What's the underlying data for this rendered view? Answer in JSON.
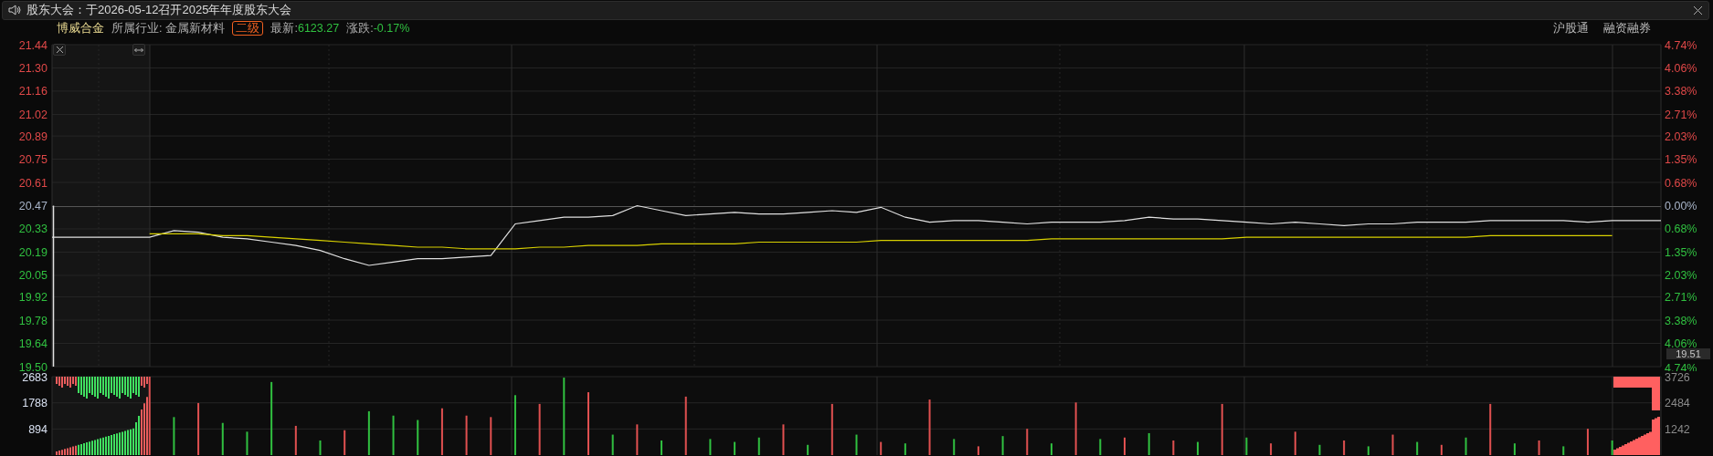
{
  "notice": {
    "text": "股东大会：于2026-05-12召开2025年年度股东大会"
  },
  "stock": {
    "name": "博威合金",
    "industry_label": "所属行业:",
    "industry": "金属新材料",
    "level_badge": "二级",
    "latest_label": "最新:",
    "latest": "6123.27",
    "change_label": "涨跌:",
    "change": "-0.17%",
    "falling": true
  },
  "tags": [
    "沪股通",
    "融资融券"
  ],
  "price_chart": {
    "chart_data": {
      "type": "line",
      "grid": true,
      "series": [
        {
          "color": "#e0e0e0",
          "values": [
            20.28,
            20.28,
            20.28,
            20.28,
            20.28,
            20.32,
            20.31,
            20.28,
            20.27,
            20.25,
            20.23,
            20.2,
            20.15,
            20.11,
            20.13,
            20.15,
            20.15,
            20.16,
            20.17,
            20.36,
            20.38,
            20.4,
            20.4,
            20.41,
            20.47,
            20.44,
            20.41,
            20.42,
            20.43,
            20.42,
            20.42,
            20.43,
            20.44,
            20.43,
            20.46,
            20.4,
            20.37,
            20.38,
            20.38,
            20.37,
            20.36,
            20.37,
            20.37,
            20.37,
            20.38,
            20.4,
            20.39,
            20.39,
            20.38,
            20.37,
            20.36,
            20.37,
            20.36,
            20.35,
            20.36,
            20.36,
            20.37,
            20.37,
            20.37,
            20.38,
            20.38,
            20.38,
            20.38,
            20.37,
            20.38,
            20.38,
            20.38
          ]
        },
        {
          "color": "#d8d000",
          "values": [
            null,
            null,
            null,
            null,
            20.3,
            20.3,
            20.3,
            20.29,
            20.29,
            20.28,
            20.27,
            20.26,
            20.25,
            20.24,
            20.23,
            20.22,
            20.22,
            20.21,
            20.21,
            20.21,
            20.22,
            20.22,
            20.23,
            20.23,
            20.23,
            20.24,
            20.24,
            20.24,
            20.24,
            20.25,
            20.25,
            20.25,
            20.25,
            20.25,
            20.26,
            20.26,
            20.26,
            20.26,
            20.26,
            20.26,
            20.26,
            20.27,
            20.27,
            20.27,
            20.27,
            20.27,
            20.27,
            20.27,
            20.27,
            20.28,
            20.28,
            20.28,
            20.28,
            20.28,
            20.28,
            20.28,
            20.28,
            20.28,
            20.28,
            20.29,
            20.29,
            20.29,
            20.29,
            20.29,
            20.29,
            null,
            null
          ]
        }
      ],
      "ylim": [
        19.5,
        21.44
      ],
      "ref_lines": [
        {
          "value": 20.47,
          "axis": "y",
          "color": "#555555"
        }
      ],
      "yticks": [
        {
          "value": 21.44,
          "label": "21.44"
        },
        {
          "value": 21.3,
          "label": "21.30"
        },
        {
          "value": 21.16,
          "label": "21.16"
        },
        {
          "value": 21.02,
          "label": "21.02"
        },
        {
          "value": 20.89,
          "label": "20.89"
        },
        {
          "value": 20.75,
          "label": "20.75"
        },
        {
          "value": 20.61,
          "label": "20.61"
        },
        {
          "value": 20.47,
          "label": "20.47"
        },
        {
          "value": 20.33,
          "label": "20.33"
        },
        {
          "value": 20.19,
          "label": "20.19"
        },
        {
          "value": 20.05,
          "label": "20.05"
        },
        {
          "value": 19.92,
          "label": "19.92"
        },
        {
          "value": 19.78,
          "label": "19.78"
        },
        {
          "value": 19.64,
          "label": "19.64"
        },
        {
          "value": 19.5,
          "label": "19.50"
        }
      ]
    },
    "right_ticks": [
      {
        "label": "4.74%",
        "color": "#e04848"
      },
      {
        "label": "4.06%",
        "color": "#e04848"
      },
      {
        "label": "3.38%",
        "color": "#e04848"
      },
      {
        "label": "2.71%",
        "color": "#e04848"
      },
      {
        "label": "2.03%",
        "color": "#e04848"
      },
      {
        "label": "1.35%",
        "color": "#e04848"
      },
      {
        "label": "0.68%",
        "color": "#e04848"
      },
      {
        "label": "0.00%",
        "color": "#a8b4c8"
      },
      {
        "label": "0.68%",
        "color": "#30c040"
      },
      {
        "label": "1.35%",
        "color": "#30c040"
      },
      {
        "label": "2.03%",
        "color": "#30c040"
      },
      {
        "label": "2.71%",
        "color": "#30c040"
      },
      {
        "label": "3.38%",
        "color": "#30c040"
      },
      {
        "label": "4.06%",
        "color": "#30c040"
      },
      {
        "label": "4.74%",
        "color": "#30c040"
      }
    ],
    "current_price": "19.51"
  },
  "volume_chart": {
    "chart_data": {
      "type": "bar",
      "grid": true,
      "series": [
        {
          "color": "#e05050",
          "values": [
            null,
            null,
            null,
            null,
            2683,
            null,
            1780,
            null,
            null,
            null,
            1000,
            null,
            850,
            null,
            null,
            null,
            1600,
            1350,
            1300,
            null,
            1750,
            null,
            2150,
            null,
            1050,
            null,
            2000,
            null,
            null,
            null,
            1050,
            null,
            1750,
            null,
            450,
            null,
            1900,
            null,
            300,
            null,
            900,
            null,
            1800,
            null,
            600,
            null,
            500,
            null,
            1750,
            null,
            400,
            800,
            null,
            500,
            null,
            700,
            null,
            350,
            null,
            1750,
            null,
            500,
            null,
            900,
            null,
            null,
            null
          ]
        },
        {
          "color": "#30c040",
          "values": [
            null,
            null,
            null,
            null,
            null,
            1300,
            null,
            1100,
            800,
            2500,
            null,
            500,
            null,
            1500,
            1350,
            1200,
            null,
            null,
            null,
            2050,
            null,
            2650,
            null,
            700,
            null,
            500,
            null,
            550,
            450,
            600,
            null,
            350,
            null,
            700,
            null,
            400,
            null,
            550,
            null,
            650,
            null,
            400,
            null,
            550,
            null,
            750,
            null,
            450,
            null,
            600,
            null,
            null,
            350,
            null,
            300,
            null,
            450,
            null,
            600,
            null,
            400,
            null,
            300,
            null,
            500,
            null,
            null
          ]
        }
      ],
      "ylim": [
        0,
        2683
      ],
      "yticks": [
        {
          "value": 894,
          "label": "894"
        },
        {
          "value": 1788,
          "label": "1788"
        },
        {
          "value": 2683,
          "label": "2683"
        }
      ]
    },
    "right_ticks": [
      "3726",
      "2484",
      "1242"
    ]
  }
}
